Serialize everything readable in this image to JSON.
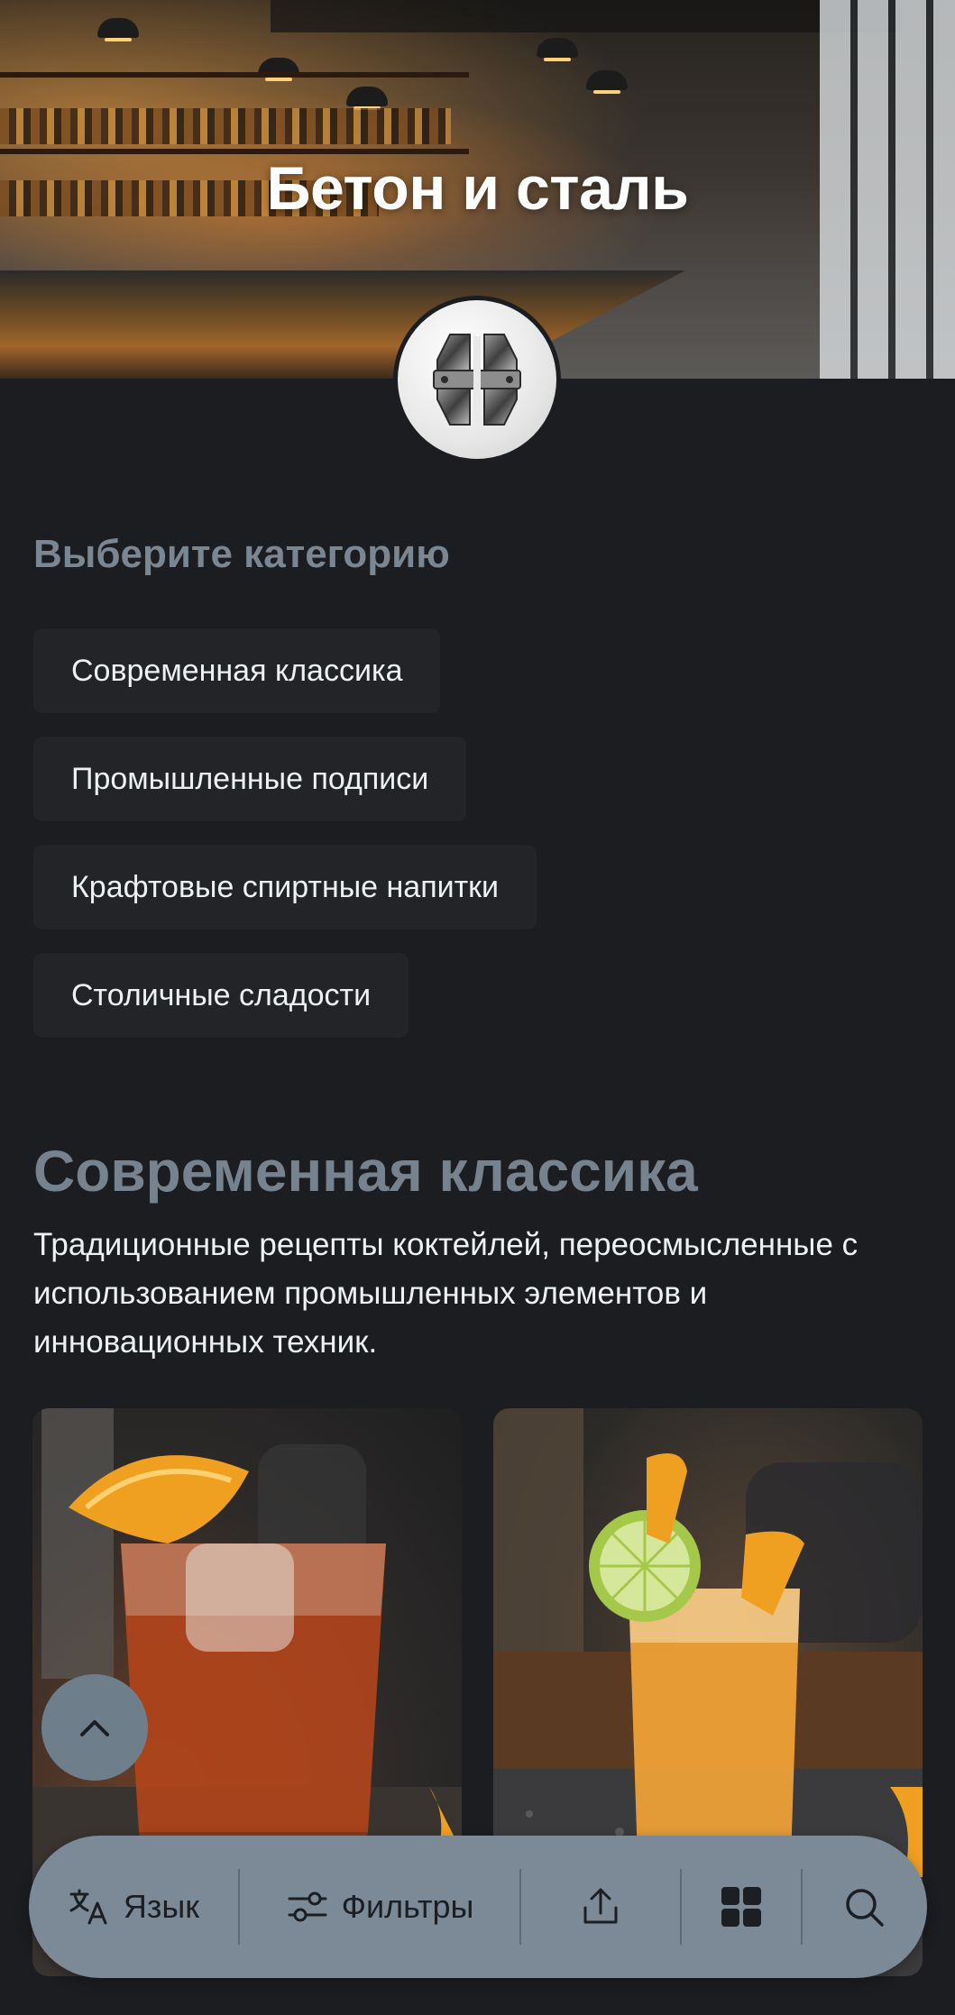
{
  "hero": {
    "title": "Бетон и сталь"
  },
  "logo": {
    "icon": "bolt-icon"
  },
  "categories": {
    "heading": "Выберите категорию",
    "items": [
      {
        "label": "Современная классика"
      },
      {
        "label": "Промышленные подписи"
      },
      {
        "label": "Крафтовые спиртные напитки"
      },
      {
        "label": "Столичные сладости"
      }
    ]
  },
  "section": {
    "title": "Современная классика",
    "description": "Традиционные рецепты коктейлей, переосмысленные с использованием промышленных элементов и инновационных техник."
  },
  "cards": [
    {
      "image": "negroni-cocktail-image"
    },
    {
      "image": "orange-highball-cocktail-image"
    }
  ],
  "bottom_bar": {
    "language_label": "Язык",
    "filters_label": "Фильтры",
    "share_icon": "share-icon",
    "grid_icon": "grid-icon",
    "search_icon": "search-icon"
  },
  "colors": {
    "background": "#1b1d20",
    "accent_gray": "#7a8793",
    "button_bg": "#222428",
    "bar_bg": "#7c8a97"
  }
}
